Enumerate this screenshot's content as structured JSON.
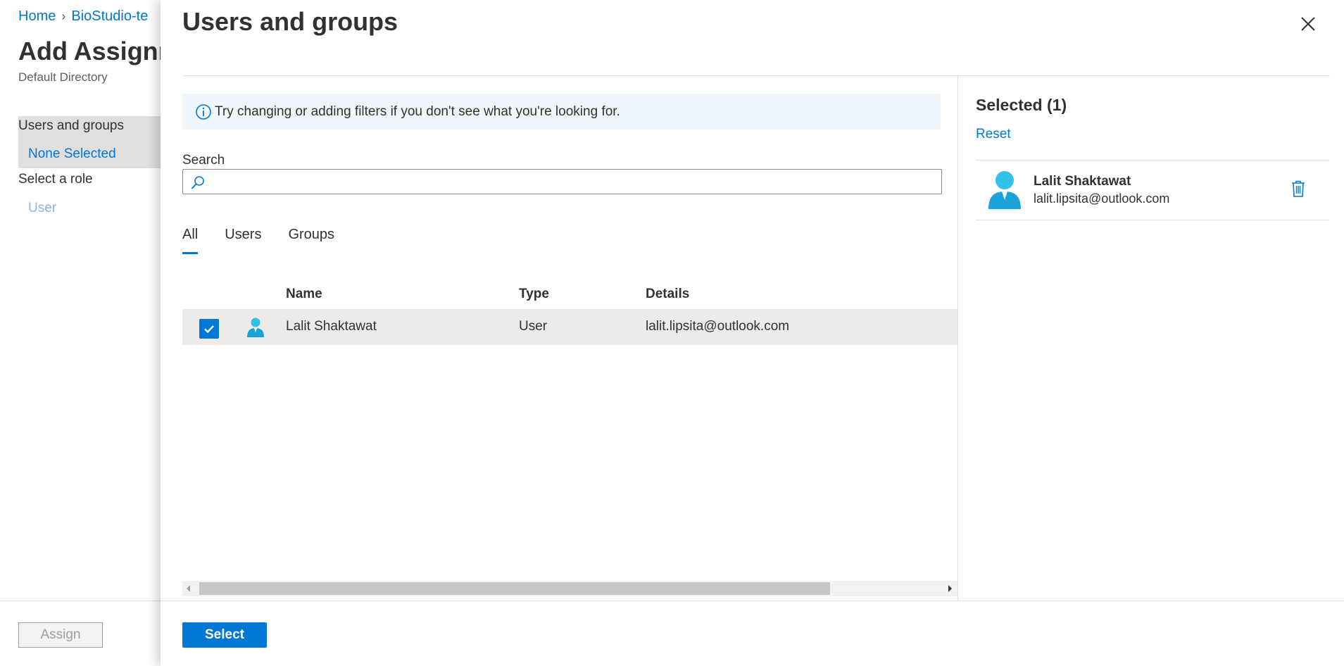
{
  "background": {
    "breadcrumb": {
      "home": "Home",
      "app": "BioStudio-te"
    },
    "title": "Add Assignn",
    "subtitle": "Default Directory",
    "users_groups": {
      "label": "Users and groups",
      "value": "None Selected"
    },
    "role": {
      "label": "Select a role",
      "value": "User"
    },
    "assign_label": "Assign"
  },
  "panel": {
    "title": "Users and groups",
    "info_text": "Try changing or adding filters if you don't see what you're looking for.",
    "search": {
      "label": "Search",
      "placeholder": "",
      "value": ""
    },
    "tabs": [
      {
        "label": "All",
        "active": true
      },
      {
        "label": "Users",
        "active": false
      },
      {
        "label": "Groups",
        "active": false
      }
    ],
    "columns": {
      "name": "Name",
      "type": "Type",
      "details": "Details"
    },
    "rows": [
      {
        "name": "Lalit Shaktawat",
        "type": "User",
        "details": "lalit.lipsita@outlook.com",
        "checked": true
      }
    ],
    "select_label": "Select",
    "selected": {
      "title": "Selected (1)",
      "reset_label": "Reset",
      "items": [
        {
          "name": "Lalit Shaktawat",
          "email": "lalit.lipsita@outlook.com"
        }
      ]
    }
  },
  "colors": {
    "accent": "#0078d4",
    "info_bg": "#eff6fc",
    "row_selected_bg": "#edebe9"
  },
  "icons": {
    "close": "close-icon",
    "info": "info-icon",
    "search": "search-icon",
    "check": "checkmark-icon",
    "user": "user-avatar-icon",
    "trash": "trash-icon",
    "chevron": "chevron-right-icon"
  }
}
